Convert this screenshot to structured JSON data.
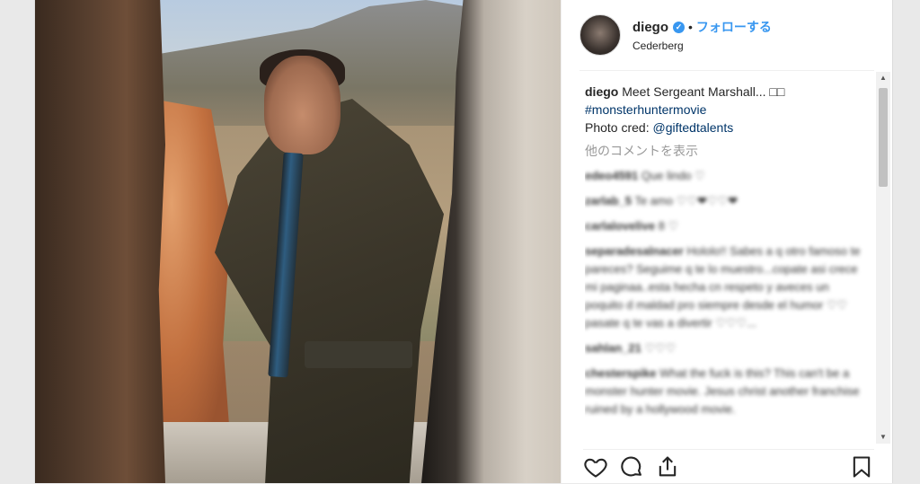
{
  "header": {
    "username": "diego",
    "separator": "•",
    "follow_label": "フォローする",
    "location": "Cederberg"
  },
  "caption": {
    "username": "diego",
    "text": "Meet Sergeant Marshall... □□",
    "hashtag": "#monsterhuntermovie",
    "credit_prefix": "Photo cred: ",
    "credit_mention": "@giftedtalents"
  },
  "more_comments_label": "他のコメントを表示",
  "comments": [
    {
      "user": "edeo4591",
      "text": "Que lindo ♡"
    },
    {
      "user": "zarlab_5",
      "text": "Te amo ♡♡❤♡♡❤"
    },
    {
      "user": "carlalovelive",
      "text": "8 ♡"
    },
    {
      "user": "separadesalnacer",
      "text": "Hololo!! Sabes a q otro famoso te pareces? Seguime q te lo muestro...copate asi crece mi paginaa..esta hecha cn respeto y aveces un poquito d maldad pro siempre desde el humor ♡♡ pasate q te vas a divertir ♡♡♡..."
    },
    {
      "user": "sahlan_21",
      "text": "♡♡♡"
    },
    {
      "user": "chesterspike",
      "text": "What the fuck is this? This can't be a monster hunter movie. Jesus christ another franchise ruined by a hollywood movie."
    }
  ],
  "scrollbar": {
    "up": "▲",
    "down": "▼"
  },
  "icons": {
    "like": "heart-icon",
    "comment": "comment-icon",
    "share": "share-icon",
    "save": "bookmark-icon"
  },
  "colors": {
    "accent": "#3897f0",
    "hashtag": "#003569",
    "text": "#262626",
    "muted": "#999999"
  }
}
